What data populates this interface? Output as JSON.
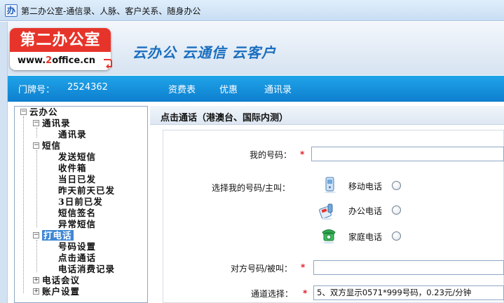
{
  "window": {
    "app_icon_glyph": "办",
    "title": "第二办公室-通信录、人脉、客户关系、随身办公"
  },
  "header": {
    "logo_cn": "第二办公室",
    "logo_url_prefix": "www.",
    "logo_url_digit": "2",
    "logo_url_suffix": "office.cn",
    "slogan": "云办公  云通信  云客户"
  },
  "nav": {
    "house_label": "门牌号：",
    "house_number": "2524362",
    "links": [
      "资费表",
      "优惠",
      "通讯录"
    ]
  },
  "tree": {
    "items": [
      {
        "label": "云办公",
        "level": 0,
        "expander": "-"
      },
      {
        "label": "通讯录",
        "level": 1,
        "expander": "-"
      },
      {
        "label": "通讯录",
        "level": 2
      },
      {
        "label": "短信",
        "level": 1,
        "expander": "-"
      },
      {
        "label": "发送短信",
        "level": 2
      },
      {
        "label": "收件箱",
        "level": 2
      },
      {
        "label": "当日已发",
        "level": 2
      },
      {
        "label": "昨天前天已发",
        "level": 2
      },
      {
        "label": "3日前已发",
        "level": 2
      },
      {
        "label": "短信签名",
        "level": 2
      },
      {
        "label": "异常短信",
        "level": 2
      },
      {
        "label": "打电话",
        "level": 1,
        "expander": "-",
        "selected": true
      },
      {
        "label": "号码设置",
        "level": 2
      },
      {
        "label": "点击通话",
        "level": 2
      },
      {
        "label": "电话消费记录",
        "level": 2
      },
      {
        "label": "电话会议",
        "level": 1,
        "expander": "+"
      },
      {
        "label": "账户设置",
        "level": 1,
        "expander": "+"
      }
    ]
  },
  "main": {
    "title": "点击通话（港澳台、国际内测）",
    "my_number_label": "我的号码：",
    "my_number_value": "",
    "required_mark": "*",
    "choose_label": "选择我的号码/主叫：",
    "options": [
      {
        "label": "移动电话",
        "icon": "mobile-phone-icon"
      },
      {
        "label": "办公电话",
        "icon": "office-phone-icon"
      },
      {
        "label": "家庭电话",
        "icon": "home-phone-icon"
      }
    ],
    "callee_label": "对方号码/被叫：",
    "callee_value": "",
    "channel_label": "通道选择：",
    "channel_value": "5、双方显示0571*999号码，0.23元/分钟"
  },
  "colors": {
    "nav_bar": "#1594dc",
    "logo_red": "#e7342a",
    "slogan_blue": "#1b6fbf",
    "required_red": "#e0202a",
    "tree_selected": "#3f87d4"
  }
}
